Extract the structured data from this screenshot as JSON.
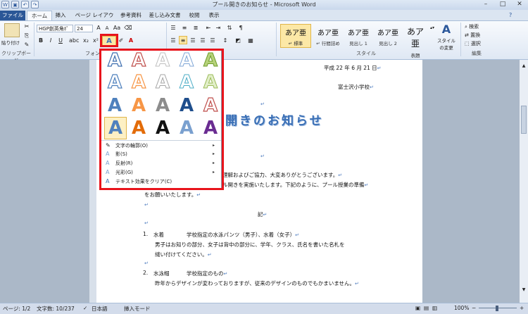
{
  "window": {
    "title": "プール開きのお知らせ - Microsoft Word"
  },
  "tabs": [
    "ファイル",
    "ホーム",
    "挿入",
    "ページ レイアウト",
    "参考資料",
    "差し込み文書",
    "校閲",
    "表示"
  ],
  "ribbon": {
    "paste_label": "貼り付け",
    "font_name": "HGP創英角ﾎﾟ",
    "font_size": "24",
    "groups": {
      "clipboard": "クリップボード",
      "font": "フォント",
      "style": "スタイル",
      "edit": "編集"
    },
    "styles": [
      {
        "sample": "あア亜",
        "name": "↵ 標準"
      },
      {
        "sample": "あア亜",
        "name": "↵ 行間詰め"
      },
      {
        "sample": "あア亜",
        "name": "見出し 1"
      },
      {
        "sample": "あア亜",
        "name": "見出し 2"
      },
      {
        "sample": "あア亜",
        "name": "表題"
      }
    ],
    "change_styles": "スタイルの変更",
    "edit_items": [
      "検索",
      "置換",
      "選択"
    ]
  },
  "gallery": {
    "glyph": "A",
    "menu": [
      {
        "label": "文字の輪郭(O)",
        "arrow": "▸"
      },
      {
        "label": "影(S)",
        "arrow": "▸"
      },
      {
        "label": "反射(R)",
        "arrow": "▸"
      },
      {
        "label": "光彩(G)",
        "arrow": "▸"
      },
      {
        "label": "テキスト効果をクリア(C)",
        "arrow": ""
      }
    ]
  },
  "document": {
    "date": "平成 22 年 6 月 21 日",
    "sender": "富士沢小学校",
    "title_fragment": "開きのお知らせ",
    "line1": "理解およびご協力、大変ありがとうございます。",
    "line2": "ル開きを実施いたします。下記のように、プール授業の準備",
    "line3": "をお願いいたします。",
    "ki": "記",
    "item1_num": "1.",
    "item1_head": "水着",
    "item1_desc": "学校指定の水泳パンツ（男子）、水着（女子）",
    "item1_line2": "男子はお知りの部分、女子は背中の部分に、学年、クラス、氏名を書いた名札を",
    "item1_line3": "縫い付けてください。",
    "item2_num": "2.",
    "item2_head": "水泳帽",
    "item2_desc": "学校指定のもの",
    "item2_line2": "昨年からデザインが変わっておりますが、従来のデザインのものでもかまいません。"
  },
  "status": {
    "page": "ページ: 1/2",
    "words": "文字数: 10/237",
    "lang": "日本語",
    "mode": "挿入モード",
    "zoom": "100%"
  },
  "colors": {
    "accent_red": "#e8141c",
    "word_blue": "#2b5797",
    "title_blue": "#3a6fb5"
  }
}
